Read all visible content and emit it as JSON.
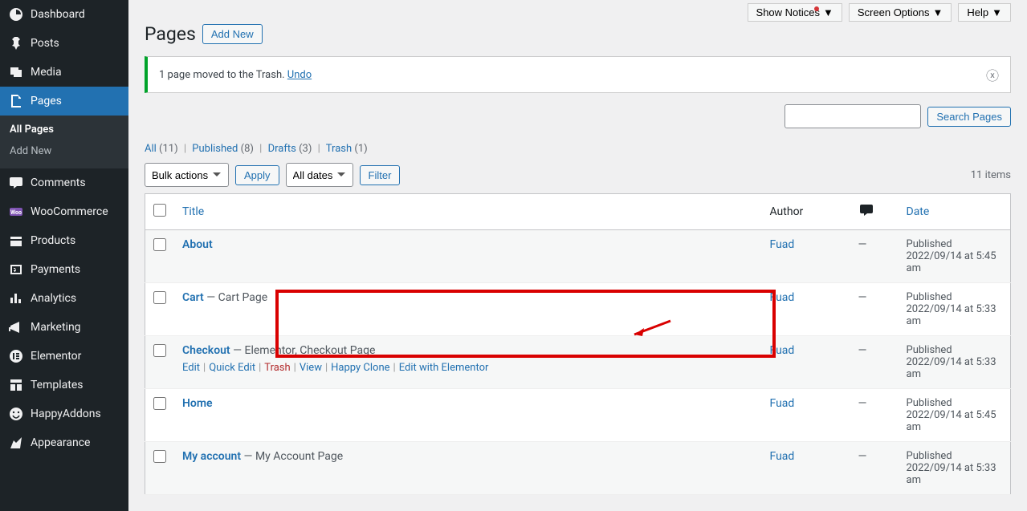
{
  "topbar": {
    "show_notices": "Show Notices",
    "screen_options": "Screen Options",
    "help": "Help"
  },
  "sidebar": [
    {
      "icon": "dashboard",
      "label": "Dashboard"
    },
    {
      "icon": "pin",
      "label": "Posts"
    },
    {
      "icon": "media",
      "label": "Media"
    },
    {
      "icon": "page",
      "label": "Pages",
      "active": true,
      "sub": [
        {
          "label": "All Pages",
          "active": true
        },
        {
          "label": "Add New"
        }
      ]
    },
    {
      "icon": "comment",
      "label": "Comments"
    },
    {
      "icon": "woo",
      "label": "WooCommerce"
    },
    {
      "icon": "product",
      "label": "Products"
    },
    {
      "icon": "payment",
      "label": "Payments"
    },
    {
      "icon": "analytics",
      "label": "Analytics"
    },
    {
      "icon": "marketing",
      "label": "Marketing"
    },
    {
      "icon": "elementor",
      "label": "Elementor"
    },
    {
      "icon": "templates",
      "label": "Templates"
    },
    {
      "icon": "happy",
      "label": "HappyAddons"
    },
    {
      "icon": "appearance",
      "label": "Appearance"
    }
  ],
  "page_title": "Pages",
  "add_new": "Add New",
  "notice_text": "1 page moved to the Trash.",
  "notice_link": "Undo",
  "filters": {
    "all": {
      "label": "All",
      "count": "(11)"
    },
    "published": {
      "label": "Published",
      "count": "(8)"
    },
    "drafts": {
      "label": "Drafts",
      "count": "(3)"
    },
    "trash": {
      "label": "Trash",
      "count": "(1)"
    }
  },
  "bulk_actions": "Bulk actions",
  "apply": "Apply",
  "all_dates": "All dates",
  "filter": "Filter",
  "items_count": "11 items",
  "search_btn": "Search Pages",
  "columns": {
    "title": "Title",
    "author": "Author",
    "date": "Date"
  },
  "row_actions": {
    "edit": "Edit",
    "quick": "Quick Edit",
    "trash": "Trash",
    "view": "View",
    "clone": "Happy Clone",
    "elementor": "Edit with Elementor"
  },
  "rows": [
    {
      "title": "About",
      "state": "",
      "author": "Fuad",
      "comments": "—",
      "date_status": "Published",
      "date": "2022/09/14 at 5:45 am"
    },
    {
      "title": "Cart",
      "state": " — Cart Page",
      "author": "Fuad",
      "comments": "—",
      "date_status": "Published",
      "date": "2022/09/14 at 5:33 am"
    },
    {
      "title": "Checkout",
      "state": " — Elementor, Checkout Page",
      "author": "Fuad",
      "comments": "—",
      "date_status": "Published",
      "date": "2022/09/14 at 5:33 am",
      "show_actions": true
    },
    {
      "title": "Home",
      "state": "",
      "author": "Fuad",
      "comments": "—",
      "date_status": "Published",
      "date": "2022/09/14 at 5:45 am"
    },
    {
      "title": "My account",
      "state": " — My Account Page",
      "author": "Fuad",
      "comments": "—",
      "date_status": "Published",
      "date": "2022/09/14 at 5:33 am"
    }
  ]
}
